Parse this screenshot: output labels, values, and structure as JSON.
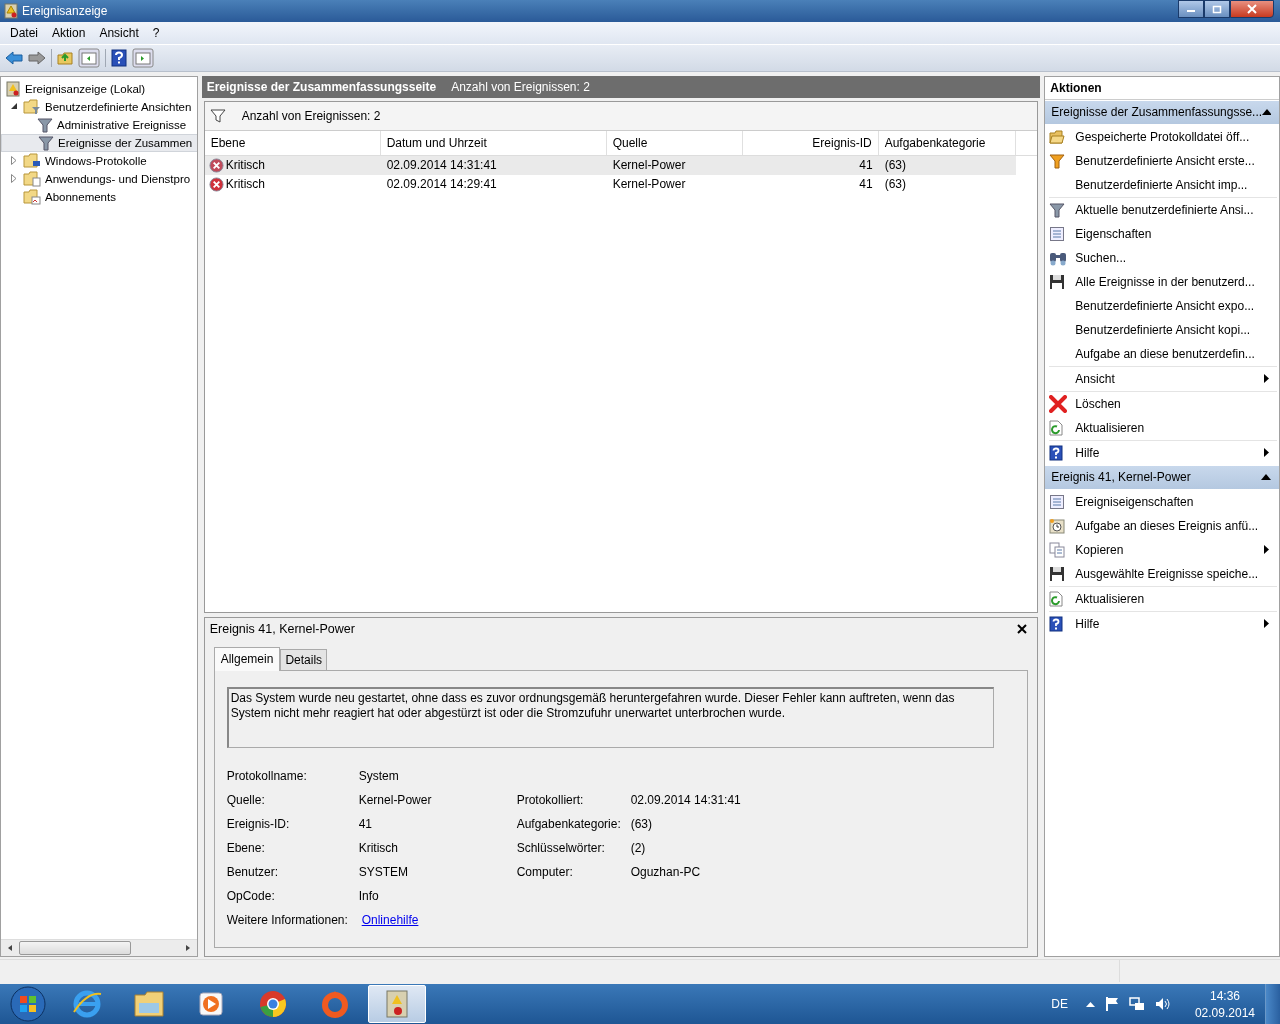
{
  "window": {
    "title": "Ereignisanzeige"
  },
  "menu": [
    {
      "label": "Datei"
    },
    {
      "label": "Aktion"
    },
    {
      "label": "Ansicht"
    },
    {
      "label": "?"
    }
  ],
  "tree": [
    {
      "label": "Ereignisanzeige (Lokal)",
      "kind": "root",
      "selected": false,
      "children": [
        {
          "label": "Benutzerdefinierte Ansichten",
          "kind": "folder-filter",
          "expanded": true,
          "selected": false,
          "children": [
            {
              "label": "Administrative Ereignisse",
              "kind": "filter",
              "selected": false
            },
            {
              "label": "Ereignisse der Zusammen",
              "kind": "filter",
              "selected": true
            }
          ]
        },
        {
          "label": "Windows-Protokolle",
          "kind": "folder-pc",
          "expanded": false,
          "selected": false
        },
        {
          "label": "Anwendungs- und Dienstpro",
          "kind": "folder-doc",
          "expanded": false,
          "selected": false
        },
        {
          "label": "Abonnements",
          "kind": "folder-sub",
          "selected": false
        }
      ]
    }
  ],
  "summary": {
    "title": "Ereignisse der Zusammenfassungsseite",
    "count": "Anzahl von Ereignissen: 2"
  },
  "filter_bar": {
    "text": "Anzahl von Ereignissen: 2"
  },
  "table": {
    "columns": [
      "Ebene",
      "Datum und Uhrzeit",
      "Quelle",
      "Ereignis-ID",
      "Aufgabenkategorie"
    ],
    "rows": [
      {
        "level": "Kritisch",
        "date": "02.09.2014 14:31:41",
        "source": "Kernel-Power",
        "id": "41",
        "category": "(63)",
        "selected": true
      },
      {
        "level": "Kritisch",
        "date": "02.09.2014 14:29:41",
        "source": "Kernel-Power",
        "id": "41",
        "category": "(63)",
        "selected": false
      }
    ]
  },
  "detail": {
    "title": "Ereignis 41, Kernel-Power",
    "tabs": [
      {
        "label": "Allgemein",
        "selected": true
      },
      {
        "label": "Details",
        "selected": false
      }
    ],
    "description": "Das System wurde neu gestartet, ohne dass es zuvor ordnungsgemäß heruntergefahren wurde. Dieser Fehler kann auftreten, wenn das System nicht mehr reagiert hat oder abgestürzt ist oder die Stromzufuhr unerwartet unterbrochen wurde.",
    "rows": [
      {
        "left": {
          "label": "Protokollname:",
          "value": "System"
        }
      },
      {
        "left": {
          "label": "Quelle:",
          "value": "Kernel-Power"
        },
        "right": {
          "label": "Protokolliert:",
          "value": "02.09.2014 14:31:41"
        }
      },
      {
        "left": {
          "label": "Ereignis-ID:",
          "value": "41"
        },
        "right": {
          "label": "Aufgabenkategorie:",
          "value": "(63)"
        }
      },
      {
        "left": {
          "label": "Ebene:",
          "value": "Kritisch"
        },
        "right": {
          "label": "Schlüsselwörter:",
          "value": "(2)"
        }
      },
      {
        "left": {
          "label": "Benutzer:",
          "value": "SYSTEM"
        },
        "right": {
          "label": "Computer:",
          "value": "Oguzhan-PC"
        }
      },
      {
        "left": {
          "label": "OpCode:",
          "value": "Info"
        }
      }
    ],
    "more_info": {
      "label": "Weitere Informationen:",
      "link": "Onlinehilfe"
    }
  },
  "actions": {
    "title": "Aktionen",
    "sections": [
      {
        "title": "Ereignisse der Zusammenfassungsse...",
        "expanded": true,
        "items": [
          {
            "label": "Gespeicherte Protokolldatei öff...",
            "kind": "folder",
            "submenu": false,
            "group_end": false
          },
          {
            "label": "Benutzerdefinierte Ansicht erste...",
            "kind": "filter-new",
            "submenu": false,
            "group_end": false
          },
          {
            "label": "Benutzerdefinierte Ansicht imp...",
            "kind": "plain",
            "submenu": false,
            "group_end": true
          },
          {
            "label": "Aktuelle benutzerdefinierte Ansi...",
            "kind": "filter",
            "submenu": false,
            "group_end": false
          },
          {
            "label": "Eigenschaften",
            "kind": "properties",
            "submenu": false,
            "group_end": false
          },
          {
            "label": "Suchen...",
            "kind": "find",
            "submenu": false,
            "group_end": false
          },
          {
            "label": "Alle Ereignisse in der benutzerd...",
            "kind": "save",
            "submenu": false,
            "group_end": false
          },
          {
            "label": "Benutzerdefinierte Ansicht expo...",
            "kind": "plain",
            "submenu": false,
            "group_end": false
          },
          {
            "label": "Benutzerdefinierte Ansicht kopi...",
            "kind": "plain",
            "submenu": false,
            "group_end": false
          },
          {
            "label": "Aufgabe an diese benutzerdefin...",
            "kind": "plain",
            "submenu": false,
            "group_end": true
          },
          {
            "label": "Ansicht",
            "kind": "plain",
            "submenu": true,
            "group_end": true
          },
          {
            "label": "Löschen",
            "kind": "delete",
            "submenu": false,
            "group_end": false
          },
          {
            "label": "Aktualisieren",
            "kind": "refresh",
            "submenu": false,
            "group_end": true
          },
          {
            "label": "Hilfe",
            "kind": "help",
            "submenu": true,
            "group_end": false
          }
        ]
      },
      {
        "title": "Ereignis 41, Kernel-Power",
        "expanded": true,
        "items": [
          {
            "label": "Ereigniseigenschaften",
            "kind": "properties",
            "submenu": false,
            "group_end": false
          },
          {
            "label": "Aufgabe an dieses Ereignis anfü...",
            "kind": "task",
            "submenu": false,
            "group_end": false
          },
          {
            "label": "Kopieren",
            "kind": "copy",
            "submenu": true,
            "group_end": false
          },
          {
            "label": "Ausgewählte Ereignisse speiche...",
            "kind": "save",
            "submenu": false,
            "group_end": true
          },
          {
            "label": "Aktualisieren",
            "kind": "refresh",
            "submenu": false,
            "group_end": true
          },
          {
            "label": "Hilfe",
            "kind": "help",
            "submenu": true,
            "group_end": false
          }
        ]
      }
    ]
  },
  "taskbar": {
    "apps": [
      {
        "kind": "browser",
        "active": false
      },
      {
        "kind": "explorer",
        "active": false
      },
      {
        "kind": "media",
        "active": false
      },
      {
        "kind": "chrome",
        "active": false
      },
      {
        "kind": "origin",
        "active": false
      },
      {
        "kind": "eventviewer",
        "active": true
      }
    ],
    "language": "DE",
    "time": "14:36",
    "date": "02.09.2014"
  }
}
